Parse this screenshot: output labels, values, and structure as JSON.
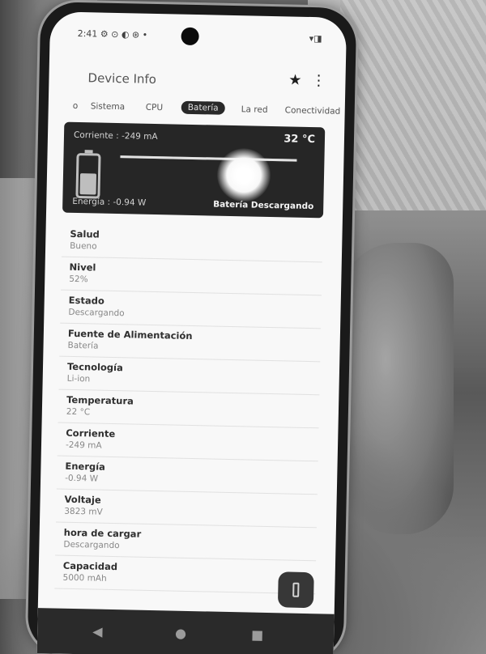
{
  "status_bar": {
    "time": "2:41 ⚙ ⊙ ◐ ⊛ •",
    "icons": "▾◨"
  },
  "app": {
    "title": "Device Info",
    "star_icon": "★",
    "menu_icon": "⋮"
  },
  "tabs": [
    {
      "label": "o",
      "active": false
    },
    {
      "label": "Sistema",
      "active": false
    },
    {
      "label": "CPU",
      "active": false
    },
    {
      "label": "Batería",
      "active": true
    },
    {
      "label": "La red",
      "active": false
    },
    {
      "label": "Conectividad",
      "active": false
    }
  ],
  "battery_card": {
    "current": "Corriente : -249 mA",
    "temperature": "32 °C",
    "energy": "Energía : -0.94 W",
    "status": "Batería Descargando",
    "level_fraction": 0.52
  },
  "details": [
    {
      "label": "Salud",
      "value": "Bueno"
    },
    {
      "label": "Nivel",
      "value": "52%"
    },
    {
      "label": "Estado",
      "value": "Descargando"
    },
    {
      "label": "Fuente de Alimentación",
      "value": "Batería"
    },
    {
      "label": "Tecnología",
      "value": "Li-ion"
    },
    {
      "label": "Temperatura",
      "value": "22 °C"
    },
    {
      "label": "Corriente",
      "value": "-249 mA"
    },
    {
      "label": "Energía",
      "value": "-0.94 W"
    },
    {
      "label": "Voltaje",
      "value": "3823 mV"
    },
    {
      "label": "hora de cargar",
      "value": "Descargando"
    },
    {
      "label": "Capacidad",
      "value": "5000 mAh"
    }
  ],
  "nav": {
    "back": "◀",
    "home": "●",
    "recent": "■"
  }
}
